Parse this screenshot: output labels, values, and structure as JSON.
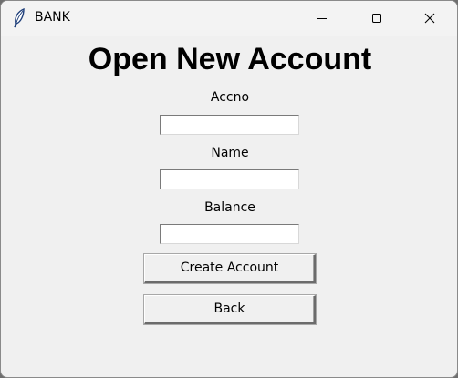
{
  "window": {
    "title": "BANK"
  },
  "form": {
    "heading": "Open New Account",
    "fields": [
      {
        "label": "Accno",
        "value": ""
      },
      {
        "label": "Name",
        "value": ""
      },
      {
        "label": "Balance",
        "value": ""
      }
    ],
    "create_label": "Create Account",
    "back_label": "Back"
  }
}
